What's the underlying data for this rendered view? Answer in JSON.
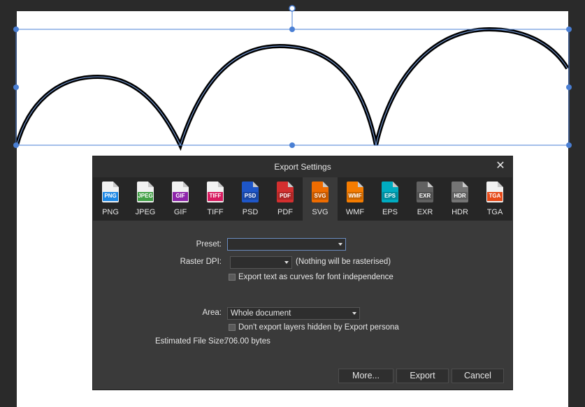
{
  "dialog": {
    "title": "Export Settings",
    "close_glyph": "✕",
    "formats": [
      {
        "badge": "PNG",
        "label": "PNG",
        "color": "#1e88e5",
        "selected": false
      },
      {
        "badge": "JPEG",
        "label": "JPEG",
        "color": "#43a047",
        "selected": false
      },
      {
        "badge": "GIF",
        "label": "GIF",
        "color": "#8e24aa",
        "selected": false
      },
      {
        "badge": "TIFF",
        "label": "TIFF",
        "color": "#d81b60",
        "selected": false
      },
      {
        "badge": "PSD",
        "label": "PSD",
        "color": "#1e56c8",
        "selected": false
      },
      {
        "badge": "PDF",
        "label": "PDF",
        "color": "#d32f2f",
        "selected": false
      },
      {
        "badge": "SVG",
        "label": "SVG",
        "color": "#ef6c00",
        "selected": true
      },
      {
        "badge": "WMF",
        "label": "WMF",
        "color": "#f57c00",
        "selected": false
      },
      {
        "badge": "EPS",
        "label": "EPS",
        "color": "#00acc1",
        "selected": false
      },
      {
        "badge": "EXR",
        "label": "EXR",
        "color": "#616161",
        "selected": false
      },
      {
        "badge": "HDR",
        "label": "HDR",
        "color": "#757575",
        "selected": false
      },
      {
        "badge": "TGA",
        "label": "TGA",
        "color": "#e64a19",
        "selected": false
      }
    ],
    "preset_label": "Preset:",
    "preset_value": "",
    "raster_dpi_label": "Raster DPI:",
    "raster_dpi_value": "",
    "raster_note": "(Nothing will be rasterised)",
    "text_as_curves_label": "Export text as curves for font independence",
    "area_label": "Area:",
    "area_value": "Whole document",
    "hidden_layers_label": "Don't export layers hidden by Export persona",
    "file_size_label": "Estimated File Size:",
    "file_size_value": "706.00 bytes",
    "buttons": {
      "more": "More...",
      "export": "Export",
      "cancel": "Cancel"
    }
  },
  "colors": {
    "selection_blue": "#4a7fd4",
    "dialog_bg": "#3a3a3a",
    "strip_bg": "#262626"
  }
}
